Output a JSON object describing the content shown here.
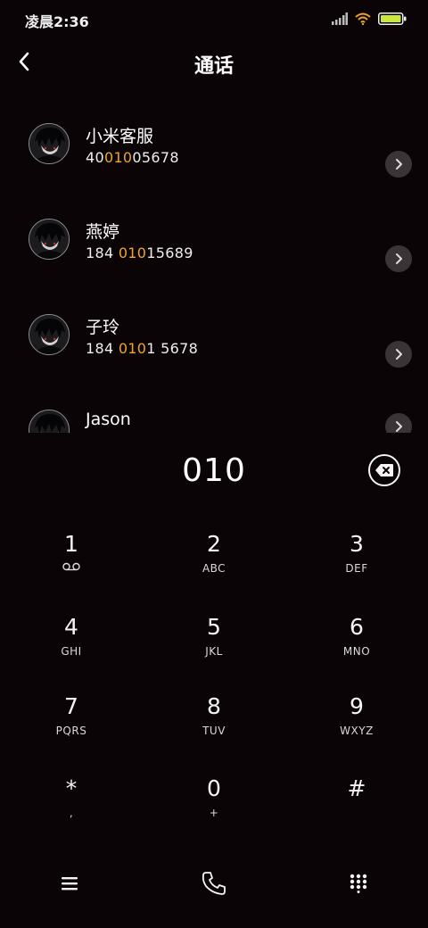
{
  "status_bar": {
    "time": "凌晨2:36",
    "icons": [
      "signal-icon",
      "wifi-icon",
      "battery-icon"
    ]
  },
  "header": {
    "title": "通话",
    "back_icon": "chevron-left-icon"
  },
  "contacts": [
    {
      "name": "小米客服",
      "number_parts": [
        "40",
        "010",
        "05678"
      ]
    },
    {
      "name": "燕婷",
      "number_parts": [
        "184 ",
        "010",
        "15689"
      ]
    },
    {
      "name": "子玲",
      "number_parts": [
        "184 ",
        "010",
        "1 5678"
      ]
    },
    {
      "name": "Jason",
      "number_parts": [
        "",
        "",
        ""
      ]
    }
  ],
  "dialer": {
    "dialed": "010",
    "backspace_icon": "backspace-icon"
  },
  "keypad": [
    {
      "digit": "1",
      "letters": "voicemail-icon"
    },
    {
      "digit": "2",
      "letters": "ABC"
    },
    {
      "digit": "3",
      "letters": "DEF"
    },
    {
      "digit": "4",
      "letters": "GHI"
    },
    {
      "digit": "5",
      "letters": "JKL"
    },
    {
      "digit": "6",
      "letters": "MNO"
    },
    {
      "digit": "7",
      "letters": "PQRS"
    },
    {
      "digit": "8",
      "letters": "TUV"
    },
    {
      "digit": "9",
      "letters": "WXYZ"
    },
    {
      "digit": "*",
      "letters": ","
    },
    {
      "digit": "0",
      "letters": "+"
    },
    {
      "digit": "#",
      "letters": ""
    }
  ],
  "bottom_bar": {
    "icons": [
      "menu-icon",
      "phone-icon",
      "dialpad-icon"
    ]
  },
  "colors": {
    "background": "#0b0406",
    "highlight": "#f0a42e",
    "text": "#f2f2f2",
    "battery": "#c9e63a"
  }
}
